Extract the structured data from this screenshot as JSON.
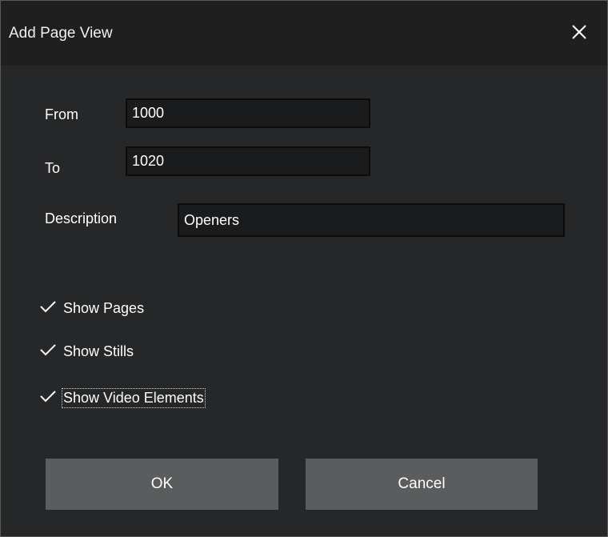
{
  "dialog": {
    "title": "Add Page View",
    "close_icon": "close-icon"
  },
  "form": {
    "from_label": "From",
    "from_value": "1000",
    "to_label": "To",
    "to_value": "1020",
    "description_label": "Description",
    "description_value": "Openers"
  },
  "options": [
    {
      "label": "Show Pages",
      "checked": true
    },
    {
      "label": "Show Stills",
      "checked": true
    },
    {
      "label": "Show Video Elements",
      "checked": true
    }
  ],
  "buttons": {
    "ok_label": "OK",
    "cancel_label": "Cancel"
  },
  "colors": {
    "background": "#262728",
    "titlebar": "#1f1f1f",
    "button": "#5a5c5e",
    "field": "#1a1b1c"
  }
}
